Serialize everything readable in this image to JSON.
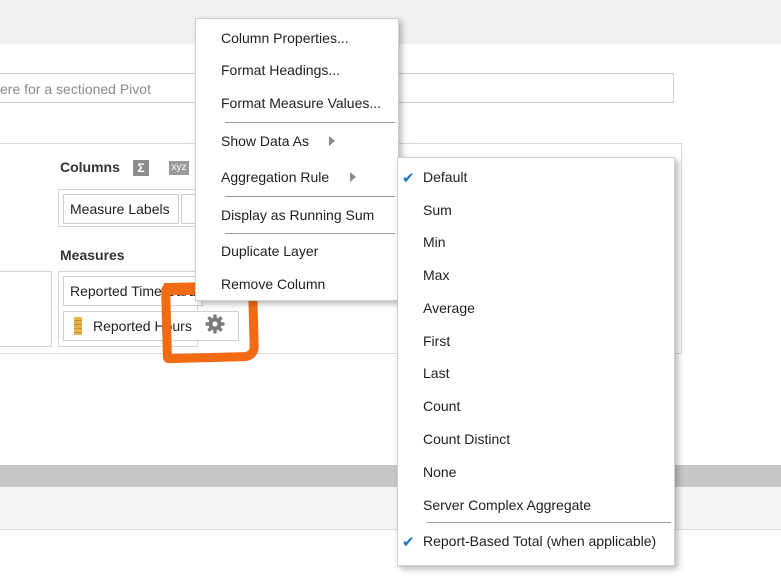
{
  "drop_target": {
    "placeholder": "ere for a sectioned Pivot"
  },
  "layout": {
    "columns_title": "Columns",
    "columns_sigma": "Σ",
    "columns_xyz": "xyz",
    "measures_title": "Measures",
    "column_chip": "Measure Labels",
    "measure_chips": [
      "Reported Time Card",
      "Reported Hours"
    ]
  },
  "context_menu": {
    "items": [
      "Column Properties...",
      "Format Headings...",
      "Format Measure Values...",
      "Show Data As",
      "Aggregation Rule",
      "Display as Running Sum",
      "Duplicate Layer",
      "Remove Column"
    ]
  },
  "aggregation_submenu": {
    "items": [
      {
        "label": "Default",
        "checked": true
      },
      {
        "label": "Sum",
        "checked": false
      },
      {
        "label": "Min",
        "checked": false
      },
      {
        "label": "Max",
        "checked": false
      },
      {
        "label": "Average",
        "checked": false
      },
      {
        "label": "First",
        "checked": false
      },
      {
        "label": "Last",
        "checked": false
      },
      {
        "label": "Count",
        "checked": false
      },
      {
        "label": "Count Distinct",
        "checked": false
      },
      {
        "label": "None",
        "checked": false
      },
      {
        "label": "Server Complex Aggregate",
        "checked": false
      },
      {
        "label": "Report-Based Total (when applicable)",
        "checked": true
      }
    ],
    "check_mark": "✔"
  },
  "colors": {
    "accent_check": "#1b74c9",
    "highlight_annotation": "#f26b12"
  }
}
